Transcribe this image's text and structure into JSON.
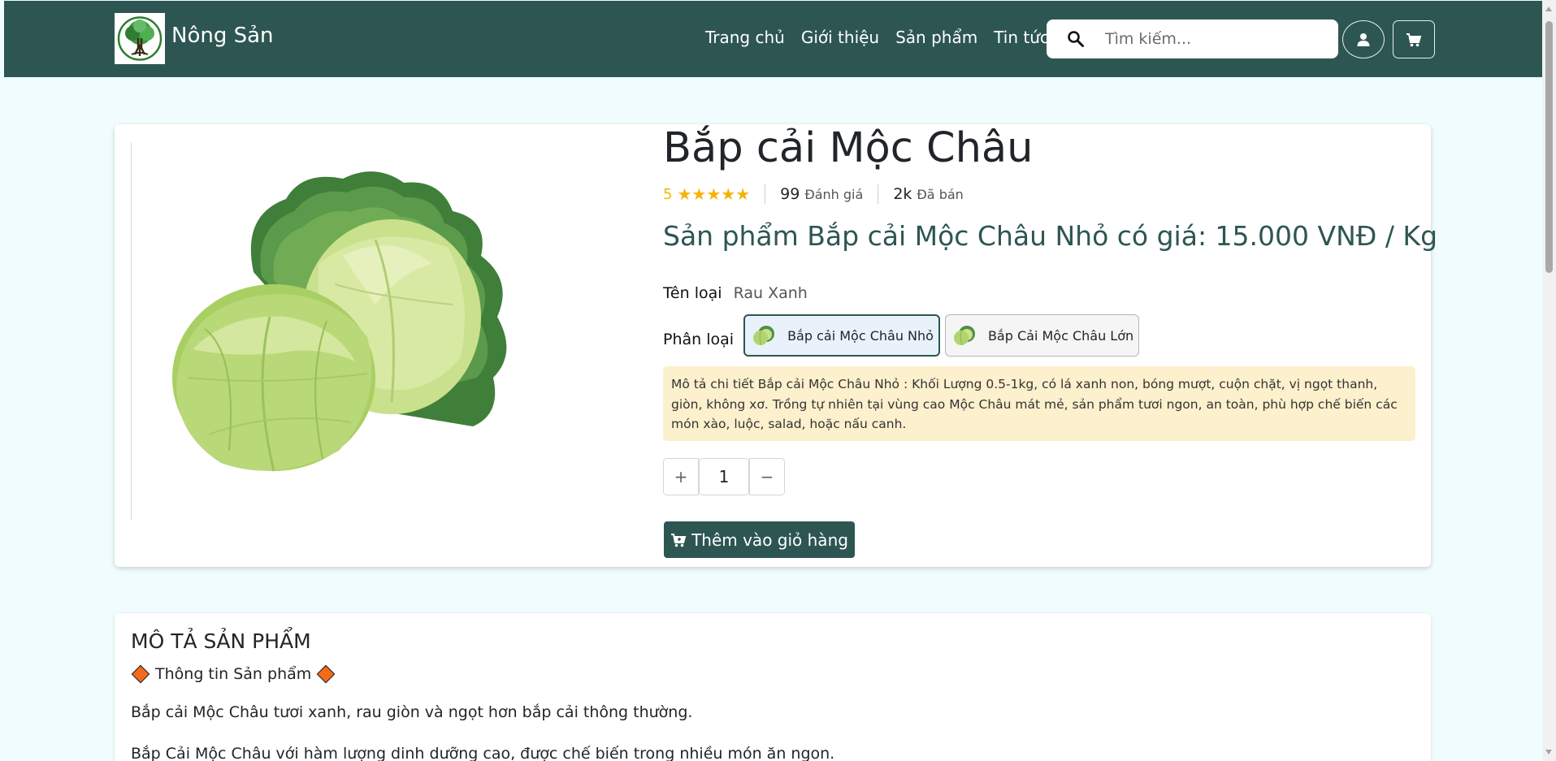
{
  "header": {
    "brand_name": "Nông Sản",
    "nav": [
      "Trang chủ",
      "Giới thiệu",
      "Sản phẩm",
      "Tin tức"
    ],
    "search_placeholder": "Tìm kiếm...",
    "icons": {
      "search": "search-icon",
      "user": "user-icon",
      "cart": "cart-icon",
      "logo": "tree-logo"
    },
    "colors": {
      "header_bg": "#2d5652",
      "page_bg": "#f0fcfd"
    }
  },
  "product": {
    "title": "Bắp cải Mộc Châu",
    "rating": "5",
    "stars": 5,
    "review_count": "99",
    "review_label": "Đánh giá",
    "sold_count": "2k",
    "sold_label": "Đã bán",
    "price_line": "Sản phẩm Bắp cải Mộc Châu Nhỏ có giá: 15.000 VNĐ / Kg",
    "type_label": "Tên loại",
    "type_value": "Rau Xanh",
    "variant_label": "Phân loại",
    "variants": [
      {
        "label": "Bắp cải Mộc Châu Nhỏ",
        "selected": true
      },
      {
        "label": "Bắp Cải Mộc Châu Lớn",
        "selected": false
      }
    ],
    "detail": "Mô tả chi tiết Bắp cải Mộc Châu Nhỏ : Khối Lượng 0.5-1kg, có lá xanh non, bóng mượt, cuộn chặt, vị ngọt thanh, giòn, không xơ. Trồng tự nhiên tại vùng cao Mộc Châu mát mẻ, sản phẩm tươi ngon, an toàn, phù hợp chế biến các món xào, luộc, salad, hoặc nấu canh.",
    "quantity": "1",
    "qty_plus": "+",
    "qty_minus": "−",
    "add_to_cart": "Thêm vào giỏ hàng",
    "accent": "#2d5652",
    "star_color": "#f5b301",
    "detail_bg": "#fdf0cd"
  },
  "description": {
    "heading": "MÔ TẢ SẢN PHẨM",
    "info_title": "Thông tin Sản phẩm",
    "paragraphs": [
      "Bắp cải Mộc Châu tươi xanh, rau giòn và ngọt hơn bắp cải thông thường.",
      "Bắp Cải Mộc Châu với hàm lượng dinh dưỡng cao, được chế biến trong nhiều món ăn ngon."
    ]
  }
}
